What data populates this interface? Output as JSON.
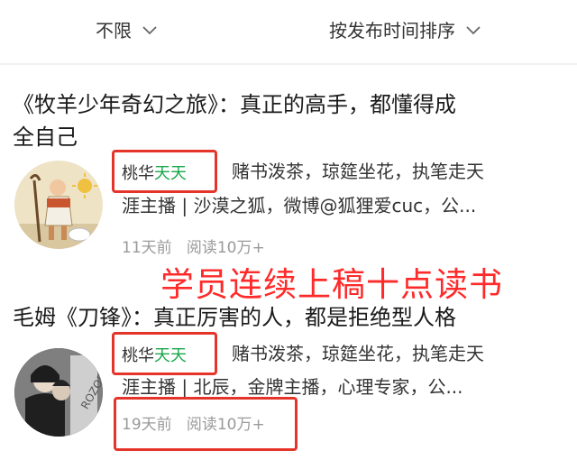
{
  "filters": {
    "left_label": "不限",
    "right_label": "按发布时间排序",
    "chevron_icon": "chevron-down-icon"
  },
  "articles": [
    {
      "title_line1": "《牧羊少年奇幻之旅》：真正的高手，都懂得成",
      "title_line2": "全自己",
      "author_part1": "桃华",
      "author_part2": "天天",
      "desc_line1": "赌书泼茶，琼筵坐花，执笔走天",
      "desc_line2": "涯主播 | 沙漠之狐，微博@狐狸爱cuc，公...",
      "time": "11天前",
      "reads": "阅读10万+"
    },
    {
      "title_line1": "毛姆《刀锋》：真正厉害的人，都是拒绝型人格",
      "author_part1": "桃华",
      "author_part2": "天天",
      "desc_line1": "赌书泼茶，琼筵坐花，执笔走天",
      "desc_line2": "涯主播 | 北辰，金牌主播，心理专家，公...",
      "time": "19天前",
      "reads": "阅读10万+"
    }
  ],
  "overlay_text": "学员连续上稿十点读书",
  "colors": {
    "highlight_box": "#e5352b",
    "author_accent": "#18a84a",
    "overlay": "#ff2a2a"
  }
}
